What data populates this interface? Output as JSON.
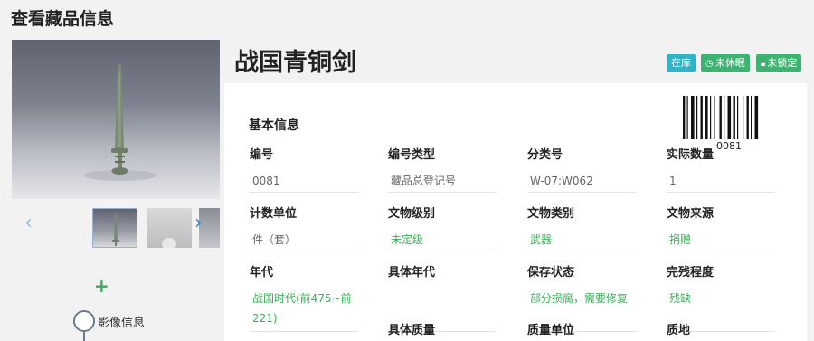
{
  "page_title": "查看藏品信息",
  "relic_title": "战国青铜剑",
  "badges": {
    "in_store": "在库",
    "not_dormant": "未休眠",
    "not_locked": "未锁定"
  },
  "section_title": "基本信息",
  "barcode_number": "0081",
  "fields": {
    "number": {
      "label": "编号",
      "value": "0081"
    },
    "number_type": {
      "label": "编号类型",
      "value": "藏品总登记号"
    },
    "category_no": {
      "label": "分类号",
      "value": "W-07:W062"
    },
    "actual_qty": {
      "label": "实际数量",
      "value": "1"
    },
    "count_unit": {
      "label": "计数单位",
      "value": "件（套）"
    },
    "relic_level": {
      "label": "文物级别",
      "value": "未定级"
    },
    "relic_category": {
      "label": "文物类别",
      "value": "武器"
    },
    "relic_source": {
      "label": "文物来源",
      "value": "捐赠"
    },
    "era": {
      "label": "年代",
      "value": "战国时代(前475~前221)"
    },
    "specific_era": {
      "label": "具体年代",
      "value": ""
    },
    "preservation": {
      "label": "保存状态",
      "value": "部分损腐，需要修复"
    },
    "completeness": {
      "label": "完残程度",
      "value": "残缺"
    },
    "specific_mass": {
      "label": "具体质量"
    },
    "mass_unit": {
      "label": "质量单位"
    },
    "material": {
      "label": "质地"
    }
  },
  "timeline": {
    "add_symbol": "+",
    "item_label": "影像信息"
  },
  "nav": {
    "prev": "‹",
    "next": "›"
  },
  "colors": {
    "accent_green": "#3cb371",
    "badge_teal": "#2fb3c8",
    "value_green": "#3cae5c"
  }
}
